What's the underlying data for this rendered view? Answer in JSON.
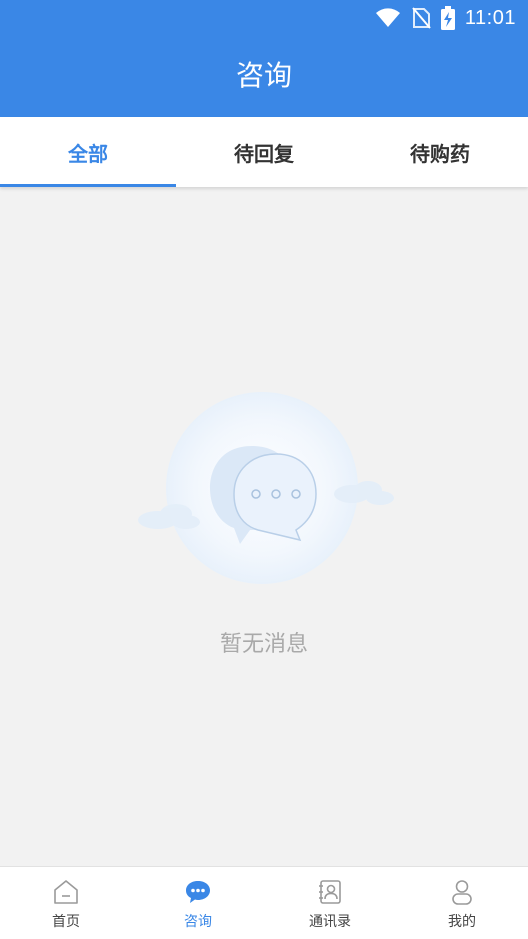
{
  "status_bar": {
    "time": "11:01",
    "icons": [
      "wifi-icon",
      "no-sim-icon",
      "battery-charging-icon"
    ]
  },
  "header": {
    "title": "咨询"
  },
  "tabs": [
    {
      "label": "全部",
      "active": true
    },
    {
      "label": "待回复",
      "active": false
    },
    {
      "label": "待购药",
      "active": false
    }
  ],
  "empty_state": {
    "icon": "chat-bubble-empty-icon",
    "message": "暂无消息"
  },
  "bottom_nav": [
    {
      "label": "首页",
      "icon": "home-icon",
      "active": false
    },
    {
      "label": "咨询",
      "icon": "chat-icon",
      "active": true
    },
    {
      "label": "通讯录",
      "icon": "contacts-icon",
      "active": false
    },
    {
      "label": "我的",
      "icon": "user-icon",
      "active": false
    }
  ],
  "colors": {
    "primary": "#3a87e6",
    "background": "#f2f2f2",
    "empty_text": "#a9a9a9"
  }
}
